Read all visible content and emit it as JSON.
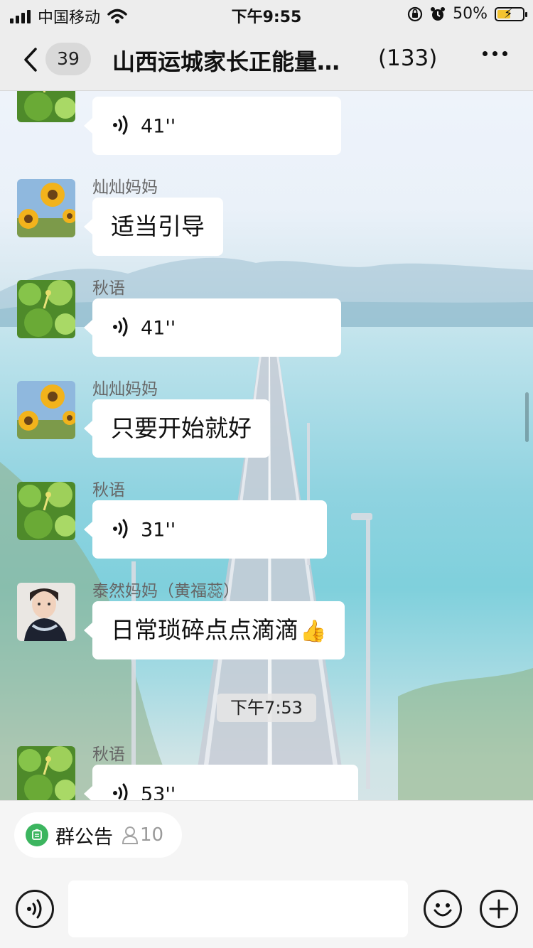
{
  "status_bar": {
    "carrier": "中国移动",
    "time": "下午9:55",
    "battery": "50%"
  },
  "nav": {
    "back_count": "39",
    "title": "山西运城家长正能量…",
    "member_count": "(133)"
  },
  "messages": [
    {
      "sender": "",
      "type": "voice",
      "duration": "41''"
    },
    {
      "sender": "灿灿妈妈",
      "type": "text",
      "text": "适当引导"
    },
    {
      "sender": "秋语",
      "type": "voice",
      "duration": "41''"
    },
    {
      "sender": "灿灿妈妈",
      "type": "text",
      "text": "只要开始就好"
    },
    {
      "sender": "秋语",
      "type": "voice",
      "duration": "31''"
    },
    {
      "sender": "泰然妈妈（黄福蕊）",
      "type": "text",
      "text": "日常琐碎点点滴滴",
      "emoji": "👍"
    },
    {
      "timestamp": "下午7:53"
    },
    {
      "sender": "秋语",
      "type": "voice",
      "duration": "53''"
    }
  ],
  "bottom": {
    "notice_label": "群公告",
    "notice_count": "10"
  },
  "colors": {
    "accent_green": "#3cb55f",
    "bubble": "#ffffff",
    "bar": "#ededed"
  }
}
